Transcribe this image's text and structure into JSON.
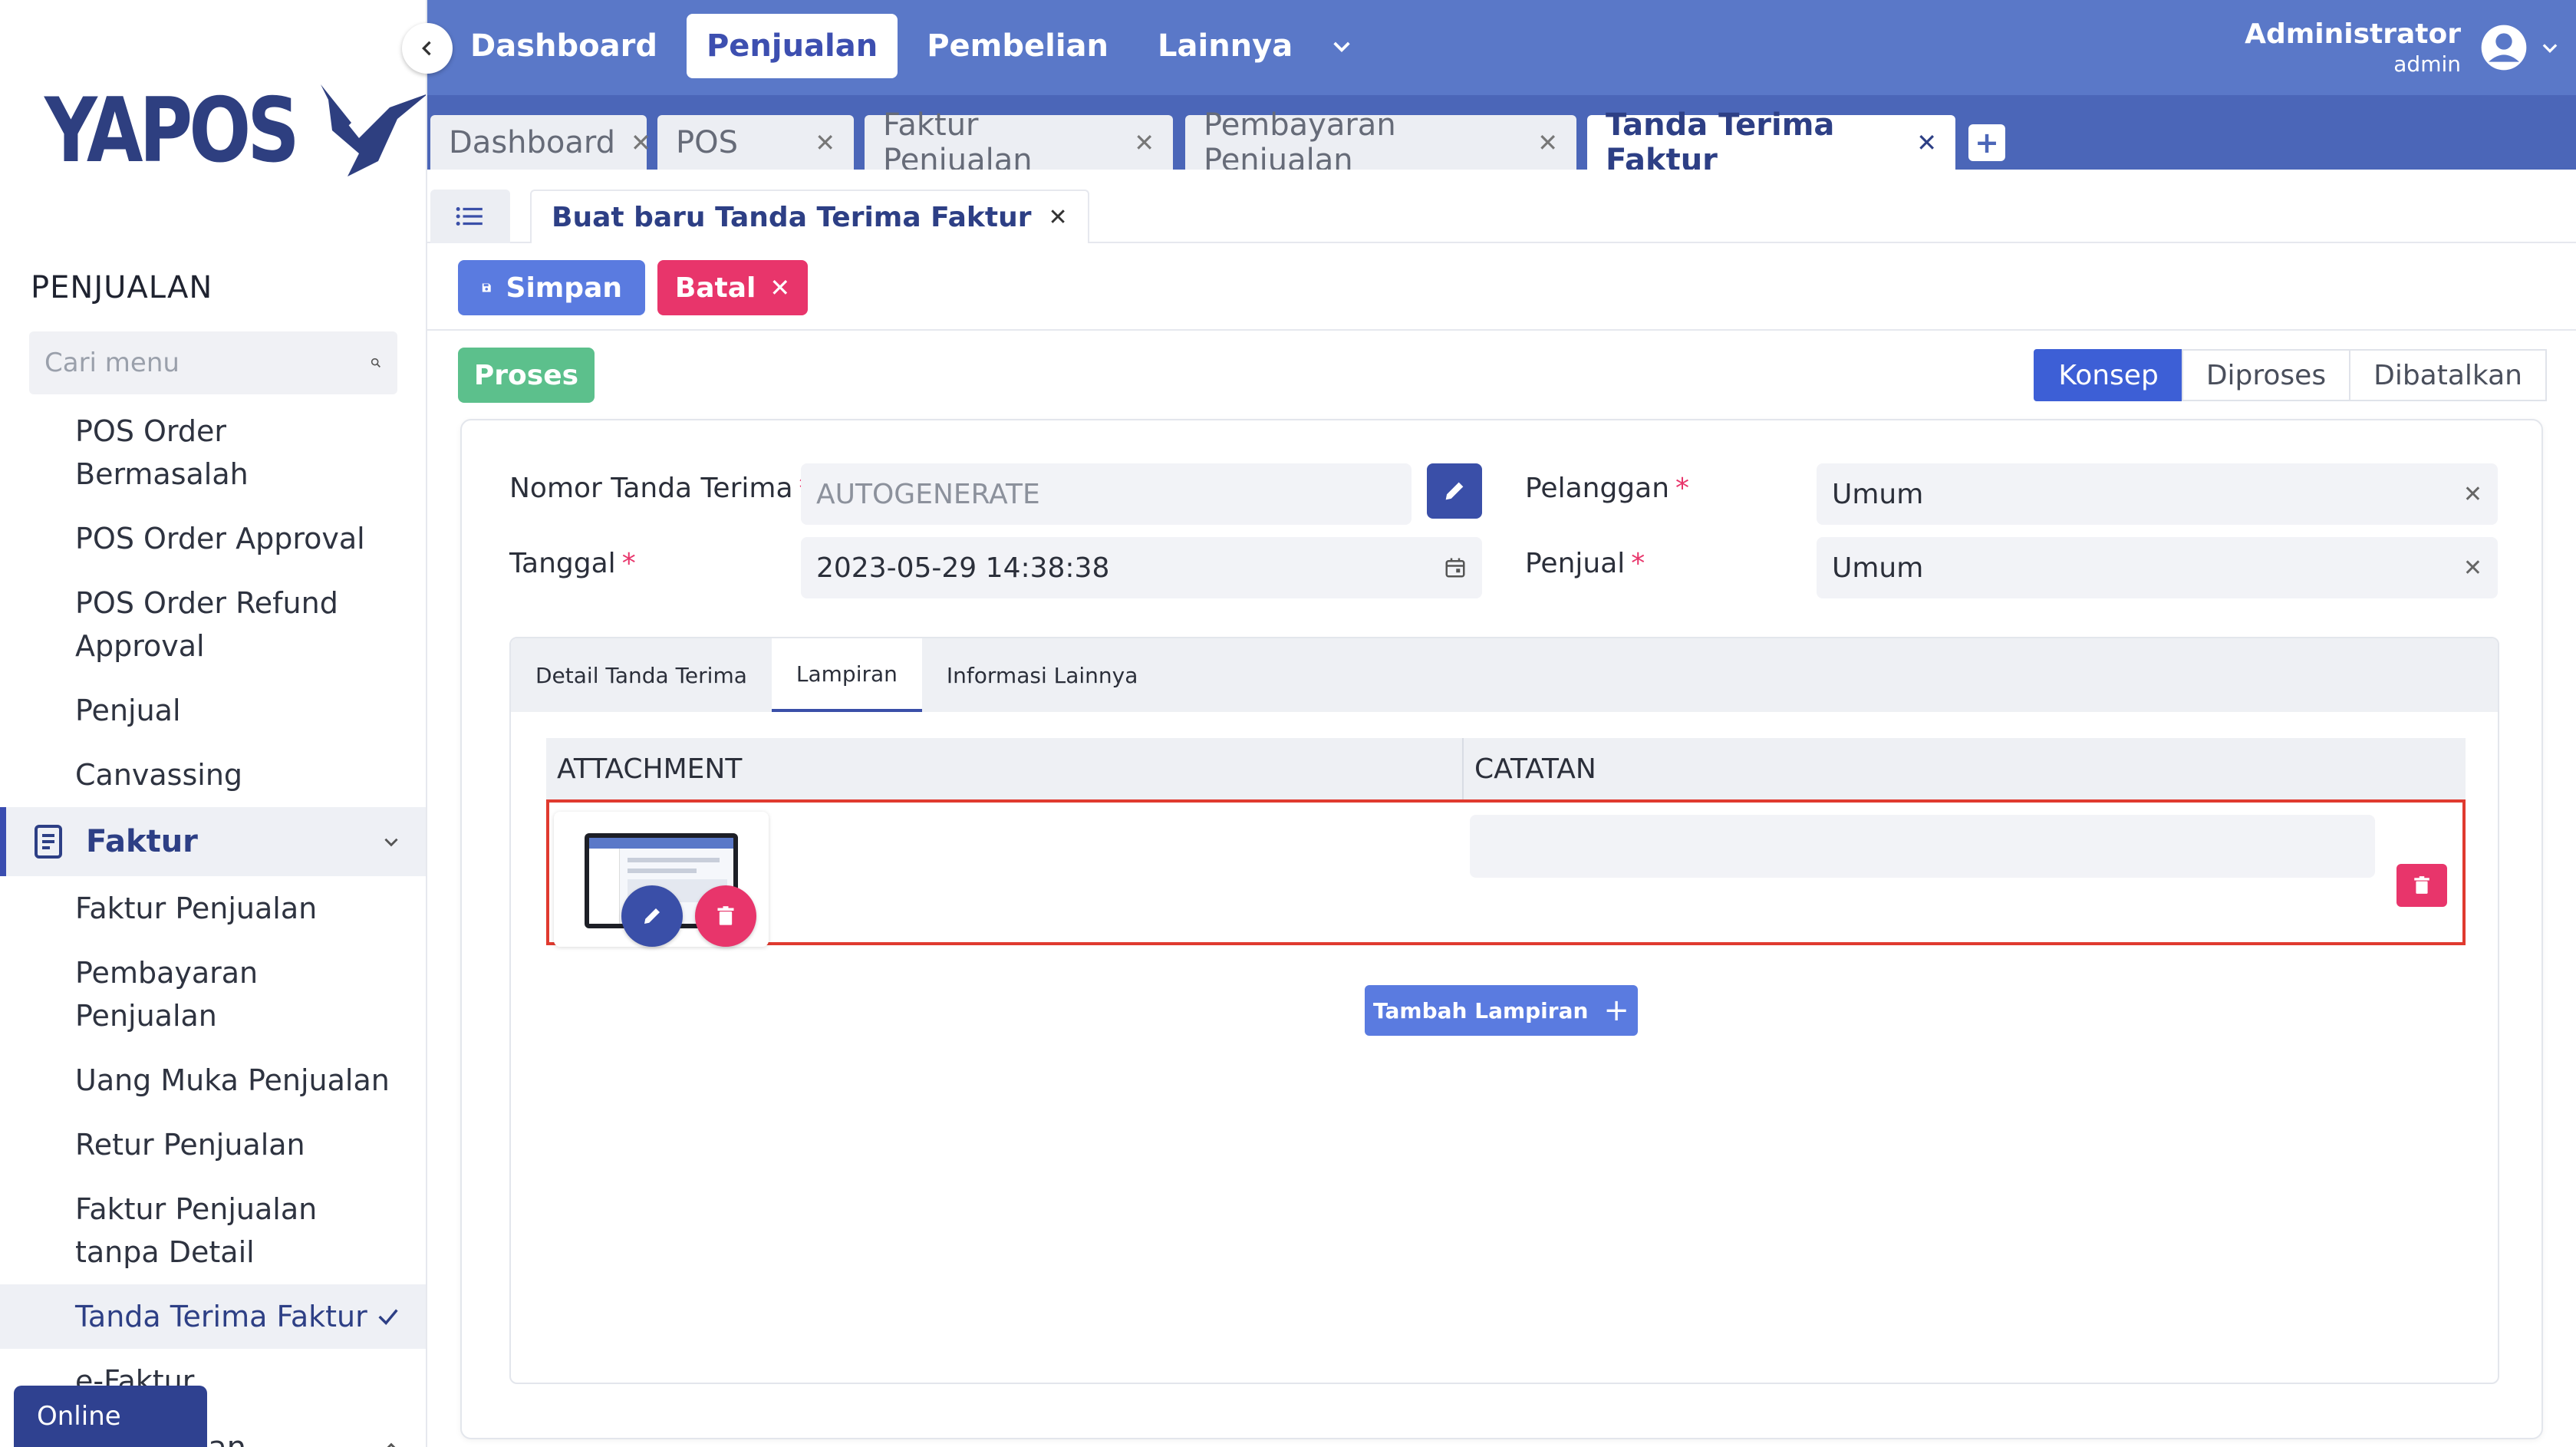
{
  "sidebar": {
    "logo_text": "YAPOS",
    "section_title": "PENJUALAN",
    "search_placeholder": "Cari menu",
    "items_top": [
      "POS Order Bermasalah",
      "POS Order Approval",
      "POS Order Refund Approval",
      "Penjual",
      "Canvassing"
    ],
    "group_faktur": "Faktur",
    "items_faktur": [
      "Faktur Penjualan",
      "Pembayaran Penjualan",
      "Uang Muka Penjualan",
      "Retur Penjualan",
      "Faktur Penjualan tanpa Detail"
    ],
    "active_item": "Tanda Terima Faktur",
    "item_efaktur": "e-Faktur",
    "group_pelanggan": "Pelanggan",
    "online_label": "Online"
  },
  "topnav": {
    "items": [
      "Dashboard",
      "Penjualan",
      "Pembelian",
      "Lainnya"
    ],
    "active": "Penjualan",
    "user_name": "Administrator",
    "user_role": "admin"
  },
  "window_tabs": [
    "Dashboard",
    "POS",
    "Faktur Penjualan",
    "Pembayaran Penjualan",
    "Tanda Terima Faktur"
  ],
  "subtab": "Buat baru Tanda Terima Faktur",
  "actions": {
    "save": "Simpan",
    "cancel": "Batal",
    "process": "Proses"
  },
  "steps": [
    "Konsep",
    "Diproses",
    "Dibatalkan"
  ],
  "form": {
    "nomor_label": "Nomor Tanda Terima",
    "nomor_placeholder": "AUTOGENERATE",
    "tanggal_label": "Tanggal",
    "tanggal_value": "2023-05-29  14:38:38",
    "pelanggan_label": "Pelanggan",
    "pelanggan_value": "Umum",
    "penjual_label": "Penjual",
    "penjual_value": "Umum",
    "required_mark": "*"
  },
  "detail_tabs": [
    "Detail Tanda Terima",
    "Lampiran",
    "Informasi Lainnya"
  ],
  "attachment_table": {
    "col_attachment": "ATTACHMENT",
    "col_note": "CATATAN",
    "add_button": "Tambah Lampiran"
  },
  "colors": {
    "topbar": "#5a78c8",
    "accent": "#3a4fa8",
    "danger": "#e8356b",
    "success": "#5cc08c"
  }
}
